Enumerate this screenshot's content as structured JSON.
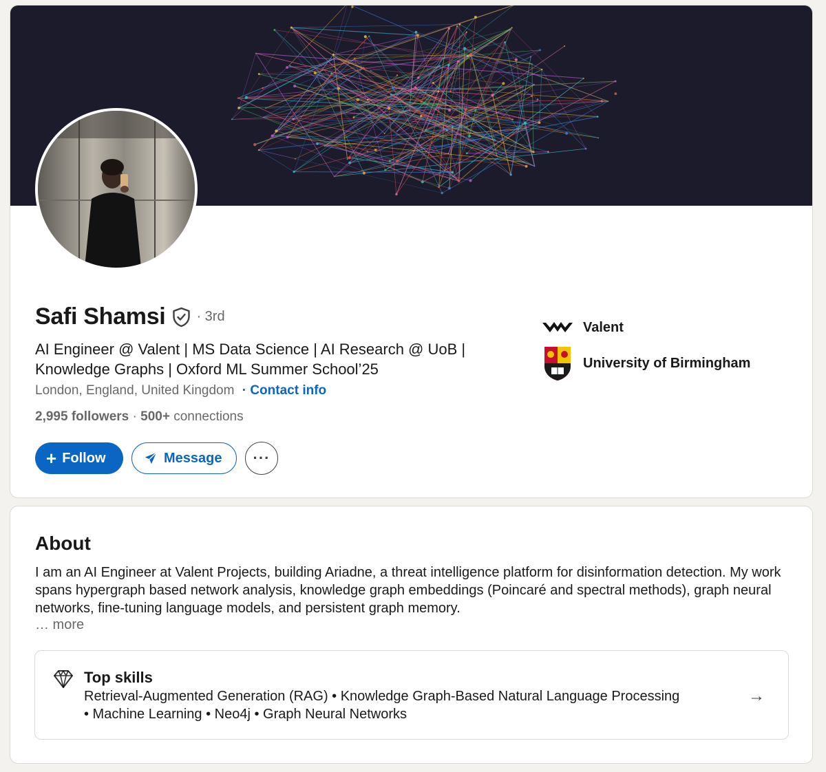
{
  "profile": {
    "name": "Safi Shamsi",
    "degree": "· 3rd",
    "headline": "AI Engineer @ Valent | MS Data Science | AI Research @ UoB | Knowledge Graphs | Oxford ML Summer School’25",
    "location": "London, England, United Kingdom",
    "contact_link": "· Contact info",
    "followers": "2,995 followers",
    "network_separator": " · ",
    "connections_count": "500+",
    "connections_label": " connections",
    "icons": {
      "verified": "verified-shield-icon",
      "avatar": "profile-photo"
    }
  },
  "actions": {
    "follow_label": "Follow",
    "follow_icon": "plus-icon",
    "message_label": "Message",
    "message_icon": "send-icon",
    "more_label": "···"
  },
  "organizations": [
    {
      "name": "Valent",
      "icon": "valent-logo"
    },
    {
      "name": "University of Birmingham",
      "icon": "university-crest-logo"
    }
  ],
  "about": {
    "title": "About",
    "text": "I am an AI Engineer at Valent Projects, building Ariadne, a threat intelligence platform for disinformation detection. My work spans hypergraph based network analysis, knowledge graph embeddings (Poincaré and spectral methods), graph neural networks, fine-tuning language models, and persistent graph memory.",
    "more_label": "… more"
  },
  "top_skills": {
    "title": "Top skills",
    "icon": "diamond-icon",
    "line1": "Retrieval-Augmented Generation (RAG) • Knowledge Graph-Based Natural Language Processing",
    "line2": "• Machine Learning • Neo4j • Graph Neural Networks",
    "arrow": "→"
  },
  "colors": {
    "accent": "#0a66c2",
    "banner_bg": "#1b1b2b",
    "page_bg": "#f4f2ee"
  }
}
